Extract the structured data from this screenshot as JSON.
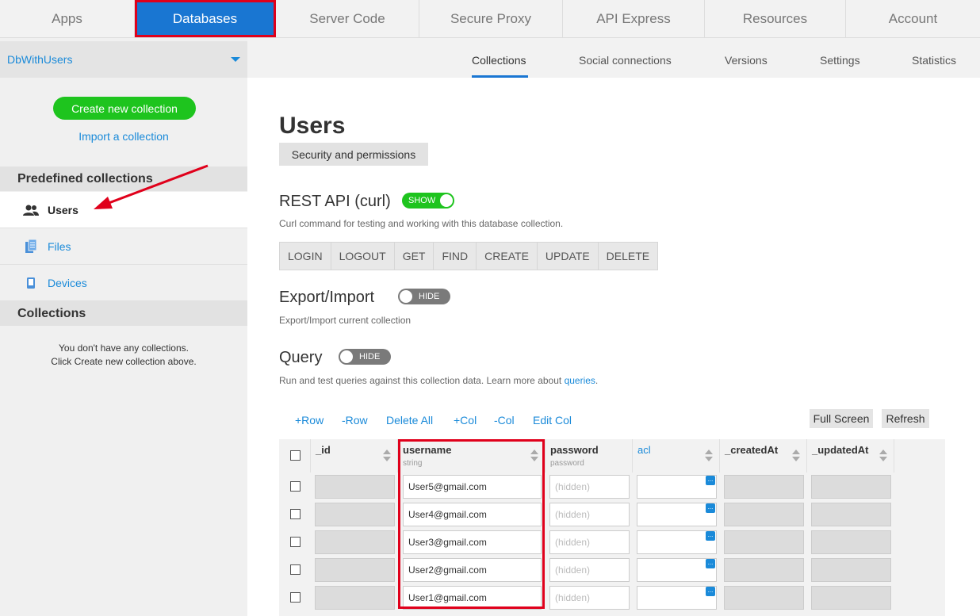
{
  "topnav": [
    {
      "label": "Apps"
    },
    {
      "label": "Databases"
    },
    {
      "label": "Server Code"
    },
    {
      "label": "Secure Proxy"
    },
    {
      "label": "API Express"
    },
    {
      "label": "Resources"
    },
    {
      "label": "Account"
    }
  ],
  "sidebar": {
    "db_name": "DbWithUsers",
    "create_label": "Create new collection",
    "import_label": "Import a collection",
    "predefined_header": "Predefined collections",
    "items": [
      {
        "label": "Users",
        "icon": "users-icon"
      },
      {
        "label": "Files",
        "icon": "files-icon"
      },
      {
        "label": "Devices",
        "icon": "device-icon"
      }
    ],
    "collections_header": "Collections",
    "empty_line1": "You don't have any collections.",
    "empty_line2": "Click Create new collection above."
  },
  "subtabs": [
    "Collections",
    "Social connections",
    "Versions",
    "Settings",
    "Statistics"
  ],
  "main": {
    "title": "Users",
    "security_label": "Security and permissions",
    "rest_title": "REST API (curl)",
    "rest_toggle": "SHOW",
    "rest_desc": "Curl command for testing and working with this database collection.",
    "curl_buttons": [
      "LOGIN",
      "LOGOUT",
      "GET",
      "FIND",
      "CREATE",
      "UPDATE",
      "DELETE"
    ],
    "export_title": "Export/Import",
    "export_toggle": "HIDE",
    "export_desc": "Export/Import current collection",
    "query_title": "Query",
    "query_toggle": "HIDE",
    "query_desc_pre": "Run and test queries against this collection data. Learn more about ",
    "query_desc_link": "queries",
    "query_desc_post": ".",
    "table_actions": [
      "+Row",
      "-Row",
      "Delete All",
      "+Col",
      "-Col",
      "Edit Col"
    ],
    "full_screen": "Full Screen",
    "refresh": "Refresh"
  },
  "table": {
    "columns": [
      {
        "name": "_id",
        "type": ""
      },
      {
        "name": "username",
        "type": "string"
      },
      {
        "name": "password",
        "type": "password"
      },
      {
        "name": "acl",
        "type": ""
      },
      {
        "name": "_createdAt",
        "type": ""
      },
      {
        "name": "_updatedAt",
        "type": ""
      }
    ],
    "rows": [
      {
        "username": "User5@gmail.com",
        "password": "(hidden)"
      },
      {
        "username": "User4@gmail.com",
        "password": "(hidden)"
      },
      {
        "username": "User3@gmail.com",
        "password": "(hidden)"
      },
      {
        "username": "User2@gmail.com",
        "password": "(hidden)"
      },
      {
        "username": "User1@gmail.com",
        "password": "(hidden)"
      }
    ],
    "acl_badge": "..."
  },
  "colors": {
    "accent": "#1976d2",
    "link": "#1a8ad9",
    "green": "#1ec41e",
    "highlight": "#e0001b"
  }
}
